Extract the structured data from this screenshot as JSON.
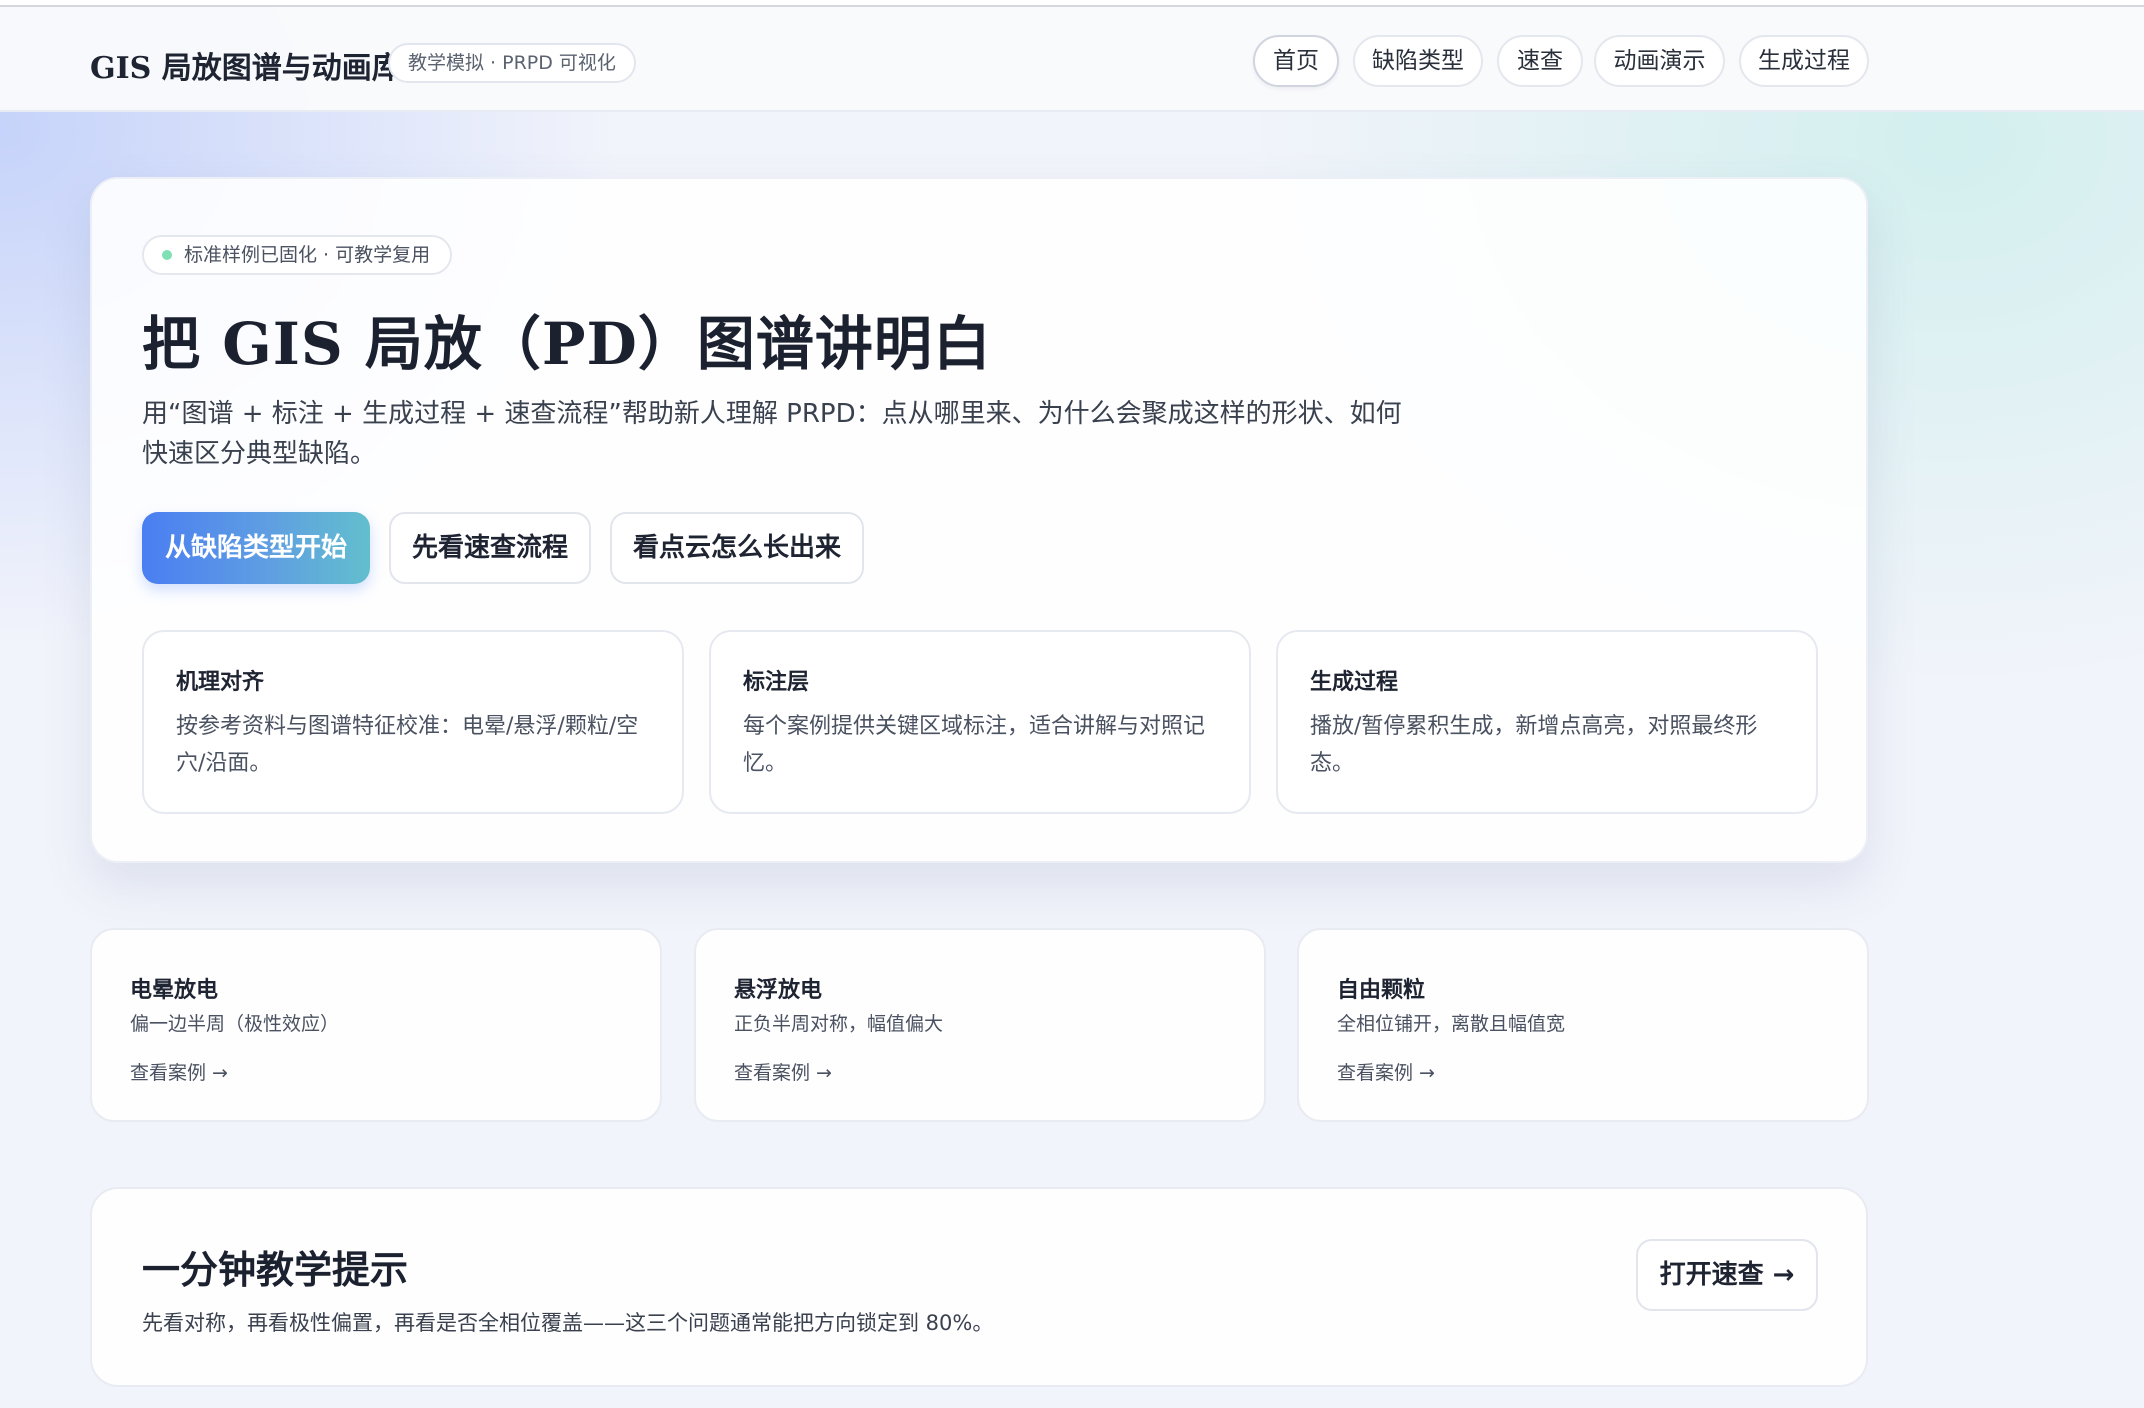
{
  "header": {
    "brand": "GIS 局放图谱与动画库",
    "badge": "教学模拟 · PRPD 可视化",
    "nav": [
      {
        "label": "首页",
        "active": true
      },
      {
        "label": "缺陷类型"
      },
      {
        "label": "速查"
      },
      {
        "label": "动画演示"
      },
      {
        "label": "生成过程"
      }
    ]
  },
  "hero": {
    "status_pill": "标准样例已固化 · 可教学复用",
    "status_color": "#7fe0b4",
    "title": "把 GIS 局放（PD）图谱讲明白",
    "description": "用“图谱 + 标注 + 生成过程 + 速查流程”帮助新人理解 PRPD：点从哪里来、为什么会聚成这样的形状、如何快速区分典型缺陷。",
    "buttons": {
      "primary": "从缺陷类型开始",
      "quick": "先看速查流程",
      "growth": "看点云怎么长出来"
    },
    "features": [
      {
        "title": "机理对齐",
        "text": "按参考资料与图谱特征校准：电晕/悬浮/颗粒/空穴/沿面。"
      },
      {
        "title": "标注层",
        "text": "每个案例提供关键区域标注，适合讲解与对照记忆。"
      },
      {
        "title": "生成过程",
        "text": "播放/暂停累积生成，新增点高亮，对照最终形态。"
      }
    ]
  },
  "defects": [
    {
      "title": "电晕放电",
      "desc": "偏一边半周（极性效应）",
      "link": "查看案例 →"
    },
    {
      "title": "悬浮放电",
      "desc": "正负半周对称，幅值偏大",
      "link": "查看案例 →"
    },
    {
      "title": "自由颗粒",
      "desc": "全相位铺开，离散且幅值宽",
      "link": "查看案例 →"
    }
  ],
  "tip": {
    "title": "一分钟教学提示",
    "text": "先看对称，再看极性偏置，再看是否全相位覆盖——这三个问题通常能把方向锁定到 80%。",
    "button": "打开速查 →"
  },
  "colors": {
    "primary_gradient_start": "#4a7ef2",
    "primary_gradient_end": "#62bfce"
  }
}
